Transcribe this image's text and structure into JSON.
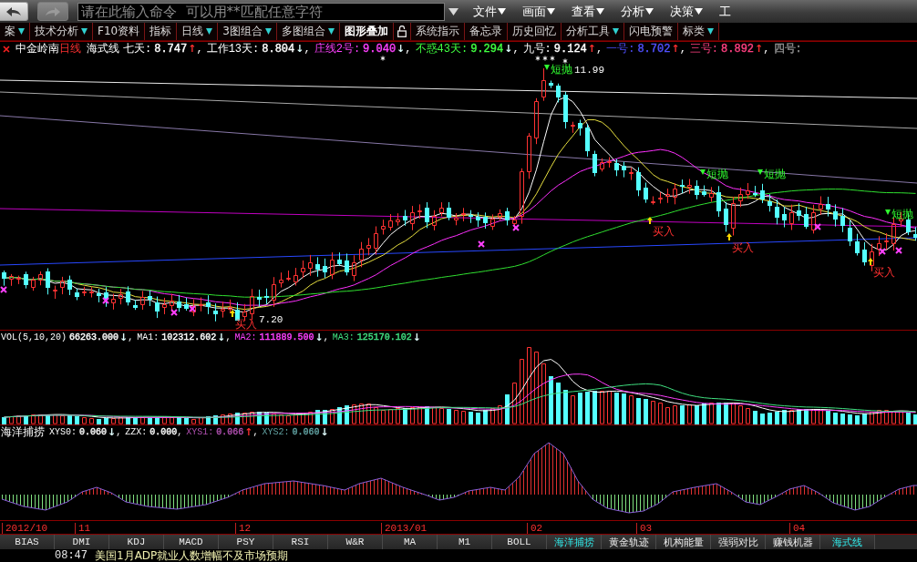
{
  "nav_buttons": [
    {
      "kind": "back",
      "disabled": false
    },
    {
      "kind": "forward",
      "disabled": true
    }
  ],
  "command_field": {
    "placeholder": "请在此输入命令  可以用**匹配任意字符"
  },
  "menu": [
    {
      "label": "文件",
      "dropdown": true
    },
    {
      "label": "画面",
      "dropdown": true
    },
    {
      "label": "查看",
      "dropdown": true
    },
    {
      "label": "分析",
      "dropdown": true
    },
    {
      "label": "决策",
      "dropdown": true
    },
    {
      "label": "工",
      "dropdown": false
    }
  ],
  "tabs": [
    {
      "label": "案",
      "dropdown": true,
      "selected": false
    },
    {
      "label": "技术分析",
      "dropdown": true,
      "selected": false
    },
    {
      "label": "F10资料",
      "dropdown": false,
      "selected": false
    },
    {
      "label": "指标",
      "dropdown": false,
      "selected": false
    },
    {
      "label": "日线",
      "dropdown": true,
      "selected": false
    },
    {
      "label": "3图组合",
      "dropdown": true,
      "selected": false
    },
    {
      "label": "多图组合",
      "dropdown": true,
      "selected": false
    },
    {
      "label": "图形叠加",
      "dropdown": false,
      "selected": true
    },
    {
      "label": "系统指示",
      "dropdown": false,
      "selected": false
    },
    {
      "label": "备忘录",
      "dropdown": false,
      "selected": false
    },
    {
      "label": "历史回忆",
      "dropdown": false,
      "selected": false
    },
    {
      "label": "分析工具",
      "dropdown": true,
      "selected": false
    },
    {
      "label": "闪电预警",
      "dropdown": false,
      "selected": false
    },
    {
      "label": "标类",
      "dropdown": true,
      "selected": false
    }
  ],
  "overlay_lock": {
    "locked": false
  },
  "chart": {
    "stock": "中金岭南",
    "period": "日线",
    "indicator": "海式线",
    "readings": [
      {
        "label": "七天:",
        "value": "8.747",
        "arrow": "↑",
        "rising": true,
        "sep": ",",
        "color": "#ffffff"
      },
      {
        "label": "工作13天:",
        "value": "8.804",
        "arrow": "↓",
        "rising": false,
        "sep": ",",
        "color": "#ffffff"
      },
      {
        "label": "庄线2号:",
        "value": "9.040",
        "arrow": "↓",
        "rising": false,
        "sep": ",",
        "color": "#ff40ff"
      },
      {
        "label": "不惑43天:",
        "value": "9.294",
        "arrow": "↓",
        "rising": false,
        "sep": ",",
        "color": "#40ff40"
      },
      {
        "label": "九号:",
        "value": "9.124",
        "arrow": "↑",
        "rising": true,
        "sep": ",",
        "color": "#ffffff"
      },
      {
        "label": "一号:",
        "value": "8.702",
        "arrow": "↑",
        "rising": true,
        "sep": ",",
        "color": "#5050ff"
      },
      {
        "label": "三号:",
        "value": "8.892",
        "arrow": "↑",
        "rising": true,
        "sep": ",",
        "color": "#ff4080"
      },
      {
        "label": "四号:",
        "color": "#909090"
      }
    ],
    "high_label": "11.99",
    "low_label": "7.20",
    "signals": [
      {
        "kind": "buy",
        "label": "买入"
      },
      {
        "kind": "sell",
        "label": "短抛"
      },
      {
        "kind": "buy",
        "label": "买入"
      },
      {
        "kind": "sell",
        "label": "短抛"
      },
      {
        "kind": "buy",
        "label": "买入"
      },
      {
        "kind": "sell",
        "label": "短抛"
      },
      {
        "kind": "buy",
        "label": "买入"
      },
      {
        "kind": "sell",
        "label": "短抛"
      }
    ]
  },
  "volume": {
    "readings": [
      {
        "label": "VOL(5,10,20)",
        "value": "66263.000",
        "arrow": "↓",
        "rising": false,
        "sep": ",",
        "color": "#ffffff"
      },
      {
        "label": "MA1:",
        "value": "102312.602",
        "arrow": "↓",
        "rising": false,
        "sep": ",",
        "color": "#ffffff"
      },
      {
        "label": "MA2:",
        "value": "111889.500",
        "arrow": "↓",
        "rising": false,
        "sep": ",",
        "color": "#ff40ff"
      },
      {
        "label": "MA3:",
        "value": "125170.102",
        "arrow": "↓",
        "rising": false,
        "color": "#40e080"
      }
    ]
  },
  "oscillator": {
    "title": "海洋捕捞",
    "readings": [
      {
        "label": "XYS0:",
        "value": "0.060",
        "arrow": "↓",
        "rising": false,
        "sep": ",",
        "color": "#ffffff"
      },
      {
        "label": "ZZX:",
        "value": "0.000",
        "sep": ",",
        "color": "#ffffff"
      },
      {
        "label": "XYS1:",
        "value": "0.066",
        "arrow": "↑",
        "rising": true,
        "sep": ",",
        "color": "#b050b0"
      },
      {
        "label": "XYS2:",
        "value": "0.060",
        "arrow": "↓",
        "rising": false,
        "color": "#60a0a0"
      }
    ]
  },
  "date_axis": {
    "labels": [
      "2012/10",
      "11",
      "12",
      "2013/01",
      "02",
      "03",
      "04"
    ]
  },
  "indicator_tabs": [
    {
      "label": "BIAS",
      "selected": false
    },
    {
      "label": "DMI",
      "selected": false
    },
    {
      "label": "KDJ",
      "selected": false
    },
    {
      "label": "MACD",
      "selected": false
    },
    {
      "label": "PSY",
      "selected": false
    },
    {
      "label": "RSI",
      "selected": false
    },
    {
      "label": "W&R",
      "selected": false
    },
    {
      "label": "MA",
      "selected": false
    },
    {
      "label": "M1",
      "selected": false
    },
    {
      "label": "BOLL",
      "selected": false
    },
    {
      "label": "海洋捕捞",
      "selected": true
    },
    {
      "label": "黄金轨迹",
      "selected": false
    },
    {
      "label": "机构能量",
      "selected": false
    },
    {
      "label": "强弱对比",
      "selected": false
    },
    {
      "label": "赚钱机器",
      "selected": false
    },
    {
      "label": "海式线",
      "selected": true
    }
  ],
  "news_ticker": {
    "time": "08:47",
    "headline": "美国1月ADP就业人数增幅不及市场预期"
  }
}
